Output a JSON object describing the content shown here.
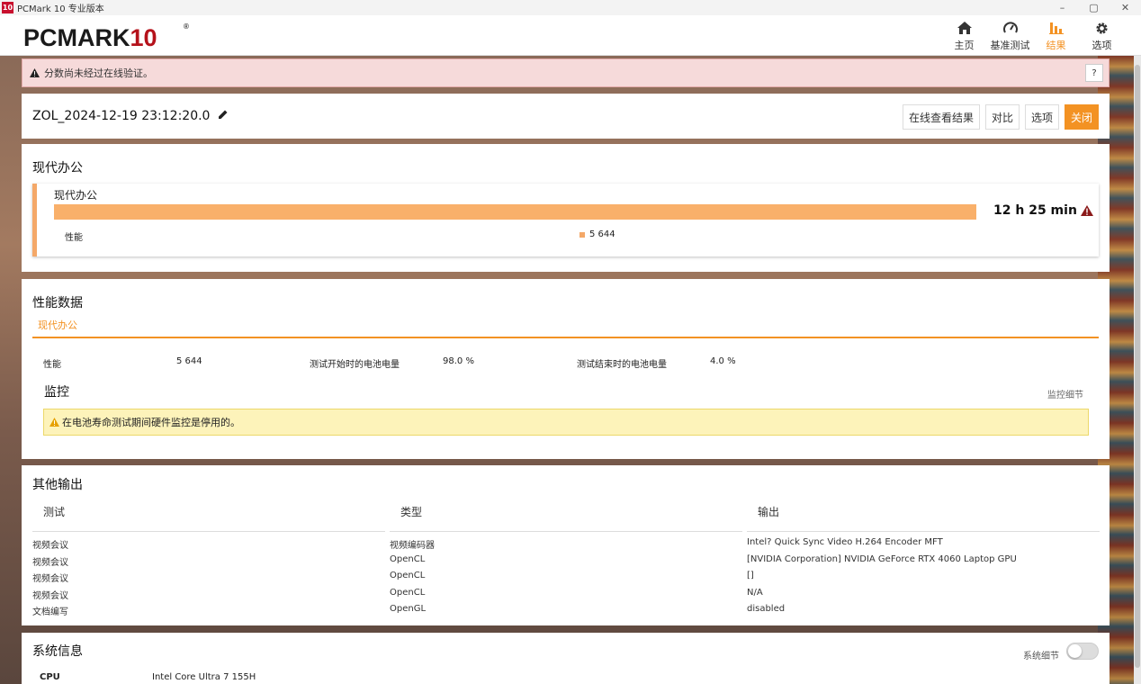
{
  "window": {
    "title": "PCMark 10 专业版本",
    "app_icon": "10",
    "controls": [
      "–",
      "▢",
      "✕"
    ]
  },
  "logo": {
    "text": "PCMARK",
    "number": "10",
    "reg": "®"
  },
  "nav": [
    {
      "label": "主页",
      "icon": "home-icon"
    },
    {
      "label": "基准测试",
      "icon": "gauge-icon"
    },
    {
      "label": "结果",
      "icon": "bar-chart-icon",
      "active": true
    },
    {
      "label": "选项",
      "icon": "gear-icon"
    }
  ],
  "colors": {
    "accent": "#f39223",
    "bar": "#f9b06a",
    "warn_bg": "#f6dada",
    "monitor_warn_bg": "#fdf3ba"
  },
  "warning": {
    "text": "分数尚未经过在线验证。",
    "help": "?"
  },
  "result": {
    "name": "ZOL_2024-12-19 23:12:20.0",
    "buttons": {
      "view_online": "在线查看结果",
      "compare": "对比",
      "options": "选项",
      "close": "关闭"
    }
  },
  "summary": {
    "title": "现代办公",
    "card_title": "现代办公",
    "duration": "12 h 25 min",
    "perf_label": "性能",
    "perf_value": "5 644"
  },
  "perfdata": {
    "title": "性能数据",
    "tab": "现代办公",
    "stats": {
      "perf_label": "性能",
      "perf_value": "5 644",
      "start_label": "测试开始时的电池电量",
      "start_value": "98.0 %",
      "end_label": "测试结束时的电池电量",
      "end_value": "4.0 %"
    },
    "monitor_title": "监控",
    "monitor_link": "监控细节",
    "monitor_warning": "在电池寿命测试期间硬件监控是停用的。"
  },
  "other": {
    "title": "其他输出",
    "headers": [
      "测试",
      "类型",
      "输出"
    ],
    "rows": [
      [
        "视频会议",
        "视频编码器",
        "Intel? Quick Sync Video H.264 Encoder MFT"
      ],
      [
        "视频会议",
        "OpenCL",
        "[NVIDIA Corporation] NVIDIA GeForce RTX 4060 Laptop GPU"
      ],
      [
        "视频会议",
        "OpenCL",
        "[]"
      ],
      [
        "视频会议",
        "OpenCL",
        "N/A"
      ],
      [
        "文档编写",
        "OpenGL",
        "disabled"
      ]
    ]
  },
  "sysinfo": {
    "title": "系统信息",
    "toggle_label": "系统细节",
    "toggle_on": false,
    "cpu_label": "CPU",
    "cpu_value": "Intel Core Ultra 7 155H"
  }
}
